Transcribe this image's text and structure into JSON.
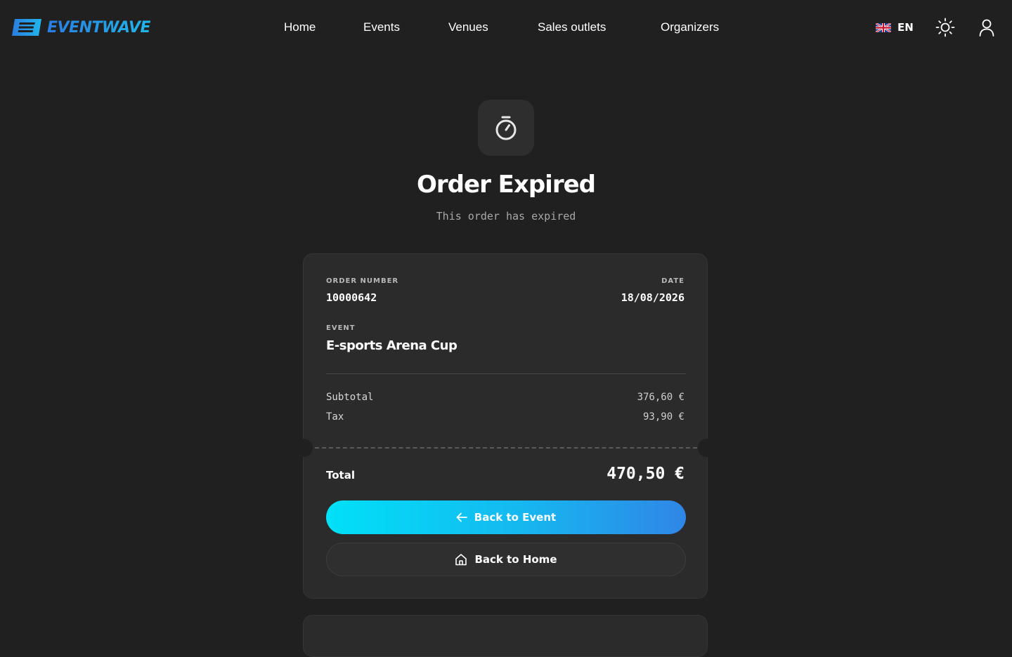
{
  "header": {
    "brand": "EVENTWAVE",
    "nav": [
      {
        "label": "Home"
      },
      {
        "label": "Events"
      },
      {
        "label": "Venues"
      },
      {
        "label": "Sales outlets"
      },
      {
        "label": "Organizers"
      }
    ],
    "language": {
      "code": "EN",
      "flag": "uk-flag-icon"
    },
    "icons": [
      "theme-toggle-sun-icon",
      "user-account-icon"
    ]
  },
  "status": {
    "icon": "stopwatch-icon",
    "title": "Order Expired",
    "subtitle": "This order has expired"
  },
  "order": {
    "order_number_label": "ORDER NUMBER",
    "order_number": "10000642",
    "date_label": "DATE",
    "date": "18/08/2026",
    "event_label": "EVENT",
    "event": "E-sports Arena Cup",
    "subtotal_label": "Subtotal",
    "subtotal": "376,60 €",
    "tax_label": "Tax",
    "tax": "93,90 €",
    "total_label": "Total",
    "total": "470,50 €"
  },
  "actions": {
    "back_to_event": "Back to Event",
    "back_to_home": "Back to Home"
  },
  "colors": {
    "background": "#202020",
    "card": "#2b2b2b",
    "accent_start": "#00e1f7",
    "accent_end": "#2f86e6",
    "muted_text": "#a9a9a9"
  }
}
